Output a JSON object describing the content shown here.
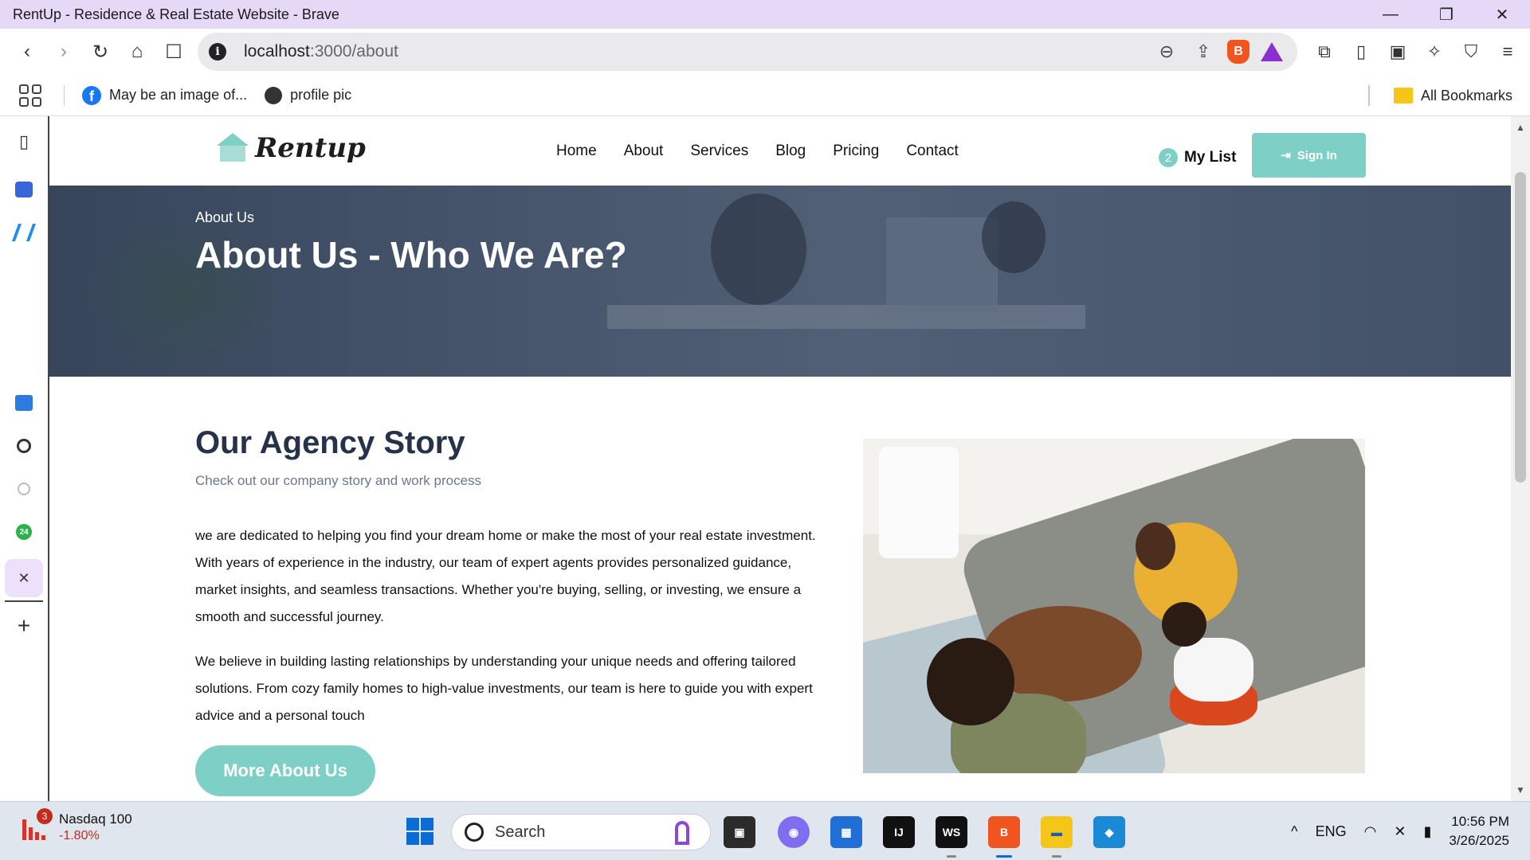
{
  "window": {
    "title": "RentUp - Residence & Real Estate Website - Brave",
    "minimize": "—",
    "restore": "❐",
    "close": "✕"
  },
  "browser": {
    "url_host": "localhost",
    "url_path": ":3000/about",
    "info_icon": "i",
    "back_icon": "‹",
    "forward_icon": "›",
    "reload_icon": "↻",
    "home_icon": "⌂",
    "bookmark_icon": "☐",
    "zoom_icon": "⊖",
    "share_icon": "⇪",
    "brave_shield_glyph": "B",
    "extensions_icon": "⧉",
    "sidebar_icon": "▯",
    "wallet_icon": "▣",
    "leo_icon": "✧",
    "vpn_icon": "⛉",
    "menu_icon": "≡"
  },
  "bookmarks": {
    "items": [
      {
        "label": "May be an image of...",
        "icon": "facebook-icon"
      },
      {
        "label": "profile pic",
        "icon": "globe-icon"
      }
    ],
    "all_label": "All Bookmarks"
  },
  "sidebar": {
    "icons": [
      "sidebar-toggle-icon",
      "print-icon",
      "wave-icon",
      "contacts-icon",
      "openai-icon",
      "home-small-icon",
      "clock-24-icon",
      "close-icon",
      "plus-icon"
    ],
    "toggle_glyph": "▯",
    "close_glyph": "✕",
    "plus_glyph": "+"
  },
  "site": {
    "brand": "Rentup",
    "nav": [
      "Home",
      "About",
      "Services",
      "Blog",
      "Pricing",
      "Contact"
    ],
    "mylist_count": "2",
    "mylist_label": "My List",
    "signin_label": "Sign In",
    "signin_icon": "⇥",
    "accent_color": "#7ecfc6",
    "hero": {
      "eyebrow": "About Us",
      "title": "About Us - Who We Are?"
    },
    "story": {
      "title": "Our Agency Story",
      "subtitle": "Check out our company story and work process",
      "paragraph1": "we are dedicated to helping you find your dream home or make the most of your real estate investment. With years of experience in the industry, our team of expert agents provides personalized guidance, market insights, and seamless transactions. Whether you're buying, selling, or investing, we ensure a smooth and successful journey.",
      "paragraph2": "We believe in building lasting relationships by understanding your unique needs and offering tailored solutions. From cozy family homes to high-value investments, our team is here to guide you with expert advice and a personal touch",
      "button": "More About Us"
    }
  },
  "taskbar": {
    "widget_name": "Nasdaq 100",
    "widget_value": "-1.80%",
    "widget_badge": "3",
    "search_label": "Search",
    "apps": [
      {
        "name": "task-view",
        "glyph": "▣",
        "color": "#2b2b2b"
      },
      {
        "name": "copilot",
        "glyph": "◉",
        "color": "#7f6df2"
      },
      {
        "name": "microsoft-store",
        "glyph": "▦",
        "color": "#1f6fd6"
      },
      {
        "name": "intellij",
        "glyph": "IJ",
        "color": "#111111"
      },
      {
        "name": "webstorm",
        "glyph": "WS",
        "color": "#111111"
      },
      {
        "name": "brave",
        "glyph": "B",
        "color": "#f0551f"
      },
      {
        "name": "file-explorer",
        "glyph": "▬",
        "color": "#f5c518"
      },
      {
        "name": "vscode",
        "glyph": "◆",
        "color": "#1a8ad4"
      }
    ],
    "tray_chevron": "^",
    "language": "ENG",
    "time": "10:56 PM",
    "date": "3/26/2025",
    "wifi_glyph": "◠",
    "volume_glyph": "✕",
    "battery_glyph": "▮"
  }
}
